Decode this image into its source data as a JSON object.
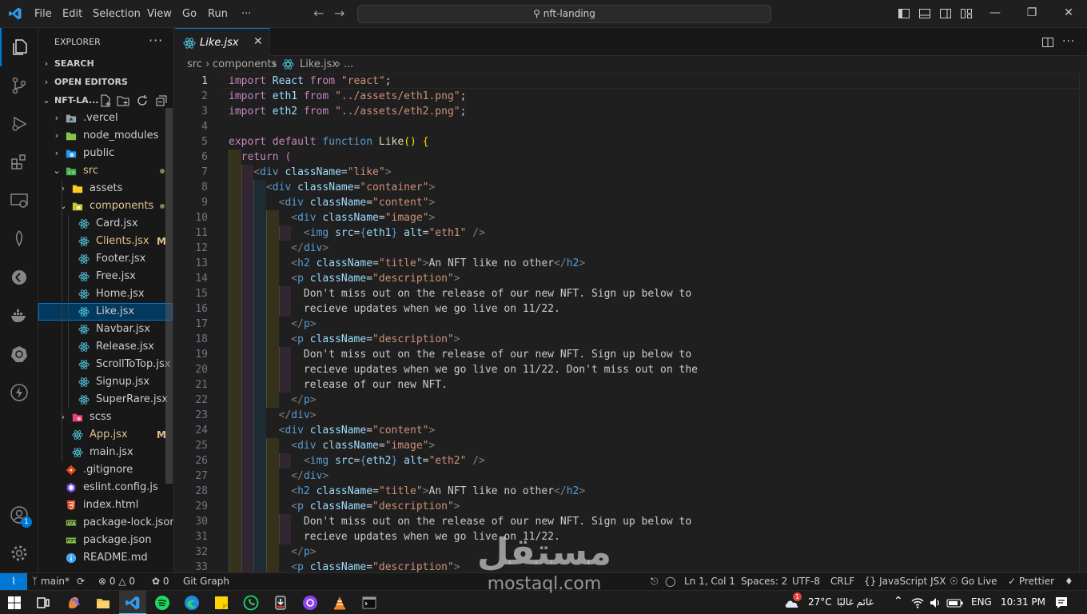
{
  "titlebar": {
    "menus": [
      "File",
      "Edit",
      "Selection",
      "View",
      "Go",
      "Run",
      "···"
    ],
    "search": "nft-landing"
  },
  "sidebar": {
    "title": "EXPLORER",
    "more": "···",
    "sections": [
      "SEARCH",
      "OPEN EDITORS",
      "NFT-LA..."
    ],
    "tree": [
      {
        "label": ".vercel",
        "level": 1,
        "type": "folder",
        "icon": "folder-gray"
      },
      {
        "label": "node_modules",
        "level": 1,
        "type": "folder",
        "icon": "folder-green"
      },
      {
        "label": "public",
        "level": 1,
        "type": "folder",
        "icon": "folder-globe"
      },
      {
        "label": "src",
        "level": 1,
        "type": "folder-open",
        "icon": "folder-src",
        "dot": true
      },
      {
        "label": "assets",
        "level": 2,
        "type": "folder",
        "icon": "folder-yellow"
      },
      {
        "label": "components",
        "level": 2,
        "type": "folder-open",
        "icon": "folder-components",
        "dot": true
      },
      {
        "label": "Card.jsx",
        "level": 3,
        "icon": "react"
      },
      {
        "label": "Clients.jsx",
        "level": 3,
        "icon": "react",
        "badge": "M"
      },
      {
        "label": "Footer.jsx",
        "level": 3,
        "icon": "react"
      },
      {
        "label": "Free.jsx",
        "level": 3,
        "icon": "react"
      },
      {
        "label": "Home.jsx",
        "level": 3,
        "icon": "react"
      },
      {
        "label": "Like.jsx",
        "level": 3,
        "icon": "react",
        "selected": true
      },
      {
        "label": "Navbar.jsx",
        "level": 3,
        "icon": "react"
      },
      {
        "label": "Release.jsx",
        "level": 3,
        "icon": "react"
      },
      {
        "label": "ScrollToTop.jsx",
        "level": 3,
        "icon": "react"
      },
      {
        "label": "Signup.jsx",
        "level": 3,
        "icon": "react"
      },
      {
        "label": "SuperRare.jsx",
        "level": 3,
        "icon": "react"
      },
      {
        "label": "scss",
        "level": 2,
        "type": "folder",
        "icon": "folder-scss"
      },
      {
        "label": "App.jsx",
        "level": 2,
        "icon": "react",
        "badge": "M"
      },
      {
        "label": "main.jsx",
        "level": 2,
        "icon": "react"
      },
      {
        "label": ".gitignore",
        "level": 1,
        "icon": "git"
      },
      {
        "label": "eslint.config.js",
        "level": 1,
        "icon": "eslint"
      },
      {
        "label": "index.html",
        "level": 1,
        "icon": "html"
      },
      {
        "label": "package-lock.json",
        "level": 1,
        "icon": "npm"
      },
      {
        "label": "package.json",
        "level": 1,
        "icon": "npm"
      },
      {
        "label": "README.md",
        "level": 1,
        "icon": "info"
      }
    ]
  },
  "editor": {
    "tab": "Like.jsx",
    "breadcrumb": [
      "src",
      "components",
      "Like.jsx",
      "..."
    ],
    "cursor_line": 1,
    "lines": [
      {
        "n": 1,
        "tokens": [
          [
            "k",
            "import"
          ],
          [
            "p",
            " "
          ],
          [
            "v",
            "React"
          ],
          [
            "p",
            " "
          ],
          [
            "k",
            "from"
          ],
          [
            "p",
            " "
          ],
          [
            "s",
            "\"react\""
          ],
          [
            "p",
            ";"
          ]
        ]
      },
      {
        "n": 2,
        "tokens": [
          [
            "k",
            "import"
          ],
          [
            "p",
            " "
          ],
          [
            "v",
            "eth1"
          ],
          [
            "p",
            " "
          ],
          [
            "k",
            "from"
          ],
          [
            "p",
            " "
          ],
          [
            "s",
            "\"../assets/eth1.png\""
          ],
          [
            "p",
            ";"
          ]
        ]
      },
      {
        "n": 3,
        "tokens": [
          [
            "k",
            "import"
          ],
          [
            "p",
            " "
          ],
          [
            "v",
            "eth2"
          ],
          [
            "p",
            " "
          ],
          [
            "k",
            "from"
          ],
          [
            "p",
            " "
          ],
          [
            "s",
            "\"../assets/eth2.png\""
          ],
          [
            "p",
            ";"
          ]
        ]
      },
      {
        "n": 4,
        "tokens": []
      },
      {
        "n": 5,
        "tokens": [
          [
            "k",
            "export"
          ],
          [
            "p",
            " "
          ],
          [
            "k",
            "default"
          ],
          [
            "p",
            " "
          ],
          [
            "b",
            "function"
          ],
          [
            "p",
            " "
          ],
          [
            "f",
            "Like"
          ],
          [
            "br",
            "()"
          ],
          [
            "p",
            " "
          ],
          [
            "br",
            "{"
          ]
        ]
      },
      {
        "n": 6,
        "tokens": [
          [
            "p",
            "  "
          ],
          [
            "k",
            "return"
          ],
          [
            "p",
            " "
          ],
          [
            "br2",
            "("
          ]
        ]
      },
      {
        "n": 7,
        "tokens": [
          [
            "p",
            "    "
          ],
          [
            "t",
            "<"
          ],
          [
            "b",
            "div"
          ],
          [
            "p",
            " "
          ],
          [
            "v",
            "className"
          ],
          [
            "p",
            "="
          ],
          [
            "s",
            "\"like\""
          ],
          [
            "t",
            ">"
          ]
        ]
      },
      {
        "n": 8,
        "tokens": [
          [
            "p",
            "      "
          ],
          [
            "t",
            "<"
          ],
          [
            "b",
            "div"
          ],
          [
            "p",
            " "
          ],
          [
            "v",
            "className"
          ],
          [
            "p",
            "="
          ],
          [
            "s",
            "\"container\""
          ],
          [
            "t",
            ">"
          ]
        ]
      },
      {
        "n": 9,
        "tokens": [
          [
            "p",
            "        "
          ],
          [
            "t",
            "<"
          ],
          [
            "b",
            "div"
          ],
          [
            "p",
            " "
          ],
          [
            "v",
            "className"
          ],
          [
            "p",
            "="
          ],
          [
            "s",
            "\"content\""
          ],
          [
            "t",
            ">"
          ]
        ]
      },
      {
        "n": 10,
        "tokens": [
          [
            "p",
            "          "
          ],
          [
            "t",
            "<"
          ],
          [
            "b",
            "div"
          ],
          [
            "p",
            " "
          ],
          [
            "v",
            "className"
          ],
          [
            "p",
            "="
          ],
          [
            "s",
            "\"image\""
          ],
          [
            "t",
            ">"
          ]
        ]
      },
      {
        "n": 11,
        "tokens": [
          [
            "p",
            "            "
          ],
          [
            "t",
            "<"
          ],
          [
            "b",
            "img"
          ],
          [
            "p",
            " "
          ],
          [
            "v",
            "src"
          ],
          [
            "p",
            "="
          ],
          [
            "b",
            "{"
          ],
          [
            "v",
            "eth1"
          ],
          [
            "b",
            "}"
          ],
          [
            "p",
            " "
          ],
          [
            "v",
            "alt"
          ],
          [
            "p",
            "="
          ],
          [
            "s",
            "\"eth1\""
          ],
          [
            "p",
            " "
          ],
          [
            "t",
            "/>"
          ]
        ]
      },
      {
        "n": 12,
        "tokens": [
          [
            "p",
            "          "
          ],
          [
            "t",
            "</"
          ],
          [
            "b",
            "div"
          ],
          [
            "t",
            ">"
          ]
        ]
      },
      {
        "n": 13,
        "tokens": [
          [
            "p",
            "          "
          ],
          [
            "t",
            "<"
          ],
          [
            "b",
            "h2"
          ],
          [
            "p",
            " "
          ],
          [
            "v",
            "className"
          ],
          [
            "p",
            "="
          ],
          [
            "s",
            "\"title\""
          ],
          [
            "t",
            ">"
          ],
          [
            "p",
            "An NFT like no other"
          ],
          [
            "t",
            "</"
          ],
          [
            "b",
            "h2"
          ],
          [
            "t",
            ">"
          ]
        ]
      },
      {
        "n": 14,
        "tokens": [
          [
            "p",
            "          "
          ],
          [
            "t",
            "<"
          ],
          [
            "b",
            "p"
          ],
          [
            "p",
            " "
          ],
          [
            "v",
            "className"
          ],
          [
            "p",
            "="
          ],
          [
            "s",
            "\"description\""
          ],
          [
            "t",
            ">"
          ]
        ]
      },
      {
        "n": 15,
        "tokens": [
          [
            "p",
            "            Don't miss out on the release of our new NFT. Sign up below to"
          ]
        ]
      },
      {
        "n": 16,
        "tokens": [
          [
            "p",
            "            recieve updates when we go live on 11/22."
          ]
        ]
      },
      {
        "n": 17,
        "tokens": [
          [
            "p",
            "          "
          ],
          [
            "t",
            "</"
          ],
          [
            "b",
            "p"
          ],
          [
            "t",
            ">"
          ]
        ]
      },
      {
        "n": 18,
        "tokens": [
          [
            "p",
            "          "
          ],
          [
            "t",
            "<"
          ],
          [
            "b",
            "p"
          ],
          [
            "p",
            " "
          ],
          [
            "v",
            "className"
          ],
          [
            "p",
            "="
          ],
          [
            "s",
            "\"description\""
          ],
          [
            "t",
            ">"
          ]
        ]
      },
      {
        "n": 19,
        "tokens": [
          [
            "p",
            "            Don't miss out on the release of our new NFT. Sign up below to"
          ]
        ]
      },
      {
        "n": 20,
        "tokens": [
          [
            "p",
            "            recieve updates when we go live on 11/22. Don't miss out on the"
          ]
        ]
      },
      {
        "n": 21,
        "tokens": [
          [
            "p",
            "            release of our new NFT."
          ]
        ]
      },
      {
        "n": 22,
        "tokens": [
          [
            "p",
            "          "
          ],
          [
            "t",
            "</"
          ],
          [
            "b",
            "p"
          ],
          [
            "t",
            ">"
          ]
        ]
      },
      {
        "n": 23,
        "tokens": [
          [
            "p",
            "        "
          ],
          [
            "t",
            "</"
          ],
          [
            "b",
            "div"
          ],
          [
            "t",
            ">"
          ]
        ]
      },
      {
        "n": 24,
        "tokens": [
          [
            "p",
            "        "
          ],
          [
            "t",
            "<"
          ],
          [
            "b",
            "div"
          ],
          [
            "p",
            " "
          ],
          [
            "v",
            "className"
          ],
          [
            "p",
            "="
          ],
          [
            "s",
            "\"content\""
          ],
          [
            "t",
            ">"
          ]
        ]
      },
      {
        "n": 25,
        "tokens": [
          [
            "p",
            "          "
          ],
          [
            "t",
            "<"
          ],
          [
            "b",
            "div"
          ],
          [
            "p",
            " "
          ],
          [
            "v",
            "className"
          ],
          [
            "p",
            "="
          ],
          [
            "s",
            "\"image\""
          ],
          [
            "t",
            ">"
          ]
        ]
      },
      {
        "n": 26,
        "tokens": [
          [
            "p",
            "            "
          ],
          [
            "t",
            "<"
          ],
          [
            "b",
            "img"
          ],
          [
            "p",
            " "
          ],
          [
            "v",
            "src"
          ],
          [
            "p",
            "="
          ],
          [
            "b",
            "{"
          ],
          [
            "v",
            "eth2"
          ],
          [
            "b",
            "}"
          ],
          [
            "p",
            " "
          ],
          [
            "v",
            "alt"
          ],
          [
            "p",
            "="
          ],
          [
            "s",
            "\"eth2\""
          ],
          [
            "p",
            " "
          ],
          [
            "t",
            "/>"
          ]
        ]
      },
      {
        "n": 27,
        "tokens": [
          [
            "p",
            "          "
          ],
          [
            "t",
            "</"
          ],
          [
            "b",
            "div"
          ],
          [
            "t",
            ">"
          ]
        ]
      },
      {
        "n": 28,
        "tokens": [
          [
            "p",
            "          "
          ],
          [
            "t",
            "<"
          ],
          [
            "b",
            "h2"
          ],
          [
            "p",
            " "
          ],
          [
            "v",
            "className"
          ],
          [
            "p",
            "="
          ],
          [
            "s",
            "\"title\""
          ],
          [
            "t",
            ">"
          ],
          [
            "p",
            "An NFT like no other"
          ],
          [
            "t",
            "</"
          ],
          [
            "b",
            "h2"
          ],
          [
            "t",
            ">"
          ]
        ]
      },
      {
        "n": 29,
        "tokens": [
          [
            "p",
            "          "
          ],
          [
            "t",
            "<"
          ],
          [
            "b",
            "p"
          ],
          [
            "p",
            " "
          ],
          [
            "v",
            "className"
          ],
          [
            "p",
            "="
          ],
          [
            "s",
            "\"description\""
          ],
          [
            "t",
            ">"
          ]
        ]
      },
      {
        "n": 30,
        "tokens": [
          [
            "p",
            "            Don't miss out on the release of our new NFT. Sign up below to"
          ]
        ]
      },
      {
        "n": 31,
        "tokens": [
          [
            "p",
            "            recieve updates when we go live on 11/22."
          ]
        ]
      },
      {
        "n": 32,
        "tokens": [
          [
            "p",
            "          "
          ],
          [
            "t",
            "</"
          ],
          [
            "b",
            "p"
          ],
          [
            "t",
            ">"
          ]
        ]
      },
      {
        "n": 33,
        "tokens": [
          [
            "p",
            "          "
          ],
          [
            "t",
            "<"
          ],
          [
            "b",
            "p"
          ],
          [
            "p",
            " "
          ],
          [
            "v",
            "className"
          ],
          [
            "p",
            "="
          ],
          [
            "s",
            "\"description\""
          ],
          [
            "t",
            ">"
          ]
        ]
      }
    ]
  },
  "statusbar": {
    "branch": "main*",
    "errors": "0",
    "warnings": "0",
    "ports": "0",
    "git_graph": "Git Graph",
    "position": "Ln 1, Col 1",
    "spaces": "Spaces: 2",
    "encoding": "UTF-8",
    "eol": "CRLF",
    "language": "JavaScript JSX",
    "golive": "Go Live",
    "prettier": "Prettier"
  },
  "taskbar": {
    "temperature": "27°C",
    "weather": "غائم غالبًا",
    "language": "ENG",
    "time": "10:31 PM",
    "weather_badge": "1"
  },
  "accounts_badge": "1",
  "watermark": {
    "arabic": "مستقل",
    "latin": "mostaql.com"
  },
  "colors": {
    "accent": "#0078d4",
    "keyword": "#c586c0",
    "string": "#ce9178",
    "tag": "#569cd6",
    "attr": "#9cdcfe",
    "func": "#dcdcaa"
  }
}
